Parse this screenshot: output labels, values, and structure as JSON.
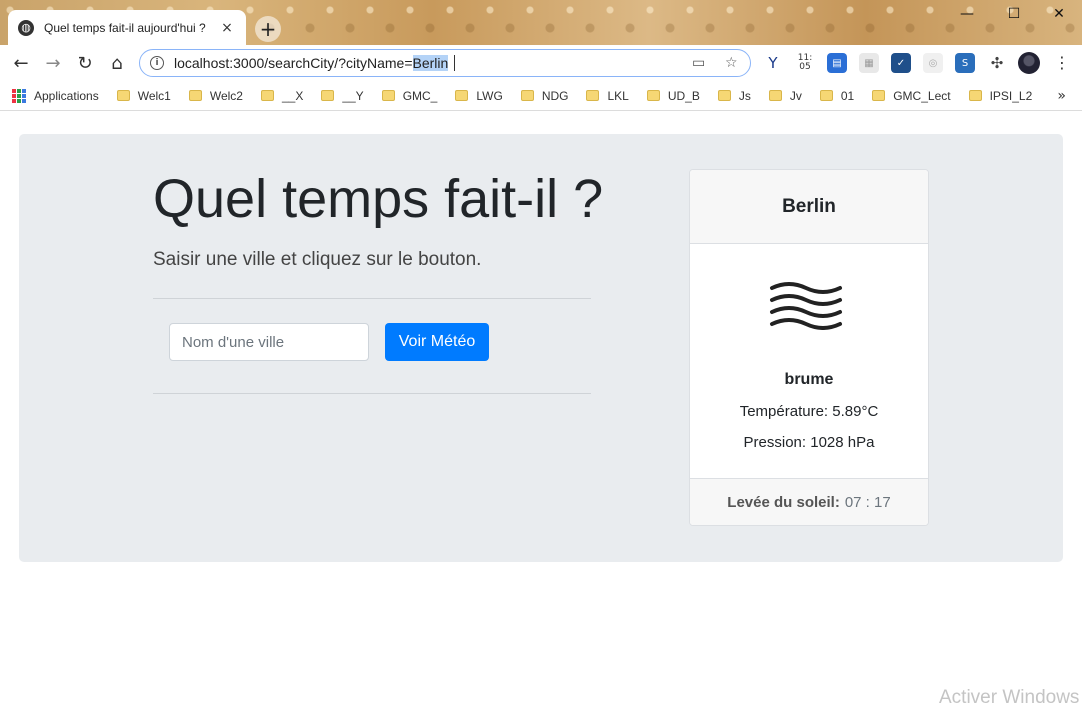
{
  "browser": {
    "tab_title": "Quel temps fait-il aujourd'hui ?",
    "tab_close": "×",
    "new_tab": "+",
    "window_controls": {
      "minimize": "—",
      "maximize": "☐",
      "close": "✕"
    },
    "url_prefix": "localhost:3000/searchCity/?cityName=",
    "url_selected": "Berlin",
    "icons": [
      "back-icon",
      "forward-icon",
      "reload-icon",
      "home-icon",
      "info-icon",
      "cast-icon",
      "star-icon",
      "extensions-icon",
      "menu-icon"
    ],
    "extension_time": "11:\n05"
  },
  "bookmarks": {
    "apps_label": "Applications",
    "items": [
      "Welc1",
      "Welc2",
      "__X",
      "__Y",
      "GMC_",
      "LWG",
      "NDG",
      "LKL",
      "UD_B",
      "Js",
      "Jv",
      "01",
      "GMC_Lect",
      "IPSI_L2"
    ],
    "more": "»"
  },
  "page": {
    "title": "Quel temps fait-il ?",
    "subtitle": "Saisir une ville et cliquez sur le bouton.",
    "input_placeholder": "Nom d'une ville",
    "button_label": "Voir Météo",
    "primary_color": "#007bff",
    "background_color": "#e9ecef"
  },
  "card": {
    "city": "Berlin",
    "icon": "mist-icon",
    "condition": "brume",
    "temperature": "Température: 5.89°C",
    "pressure": "Pression: 1028 hPa",
    "sunrise_label": "Levée du soleil:",
    "sunrise_value": "07 : 17"
  },
  "watermark": "Activer Windows"
}
